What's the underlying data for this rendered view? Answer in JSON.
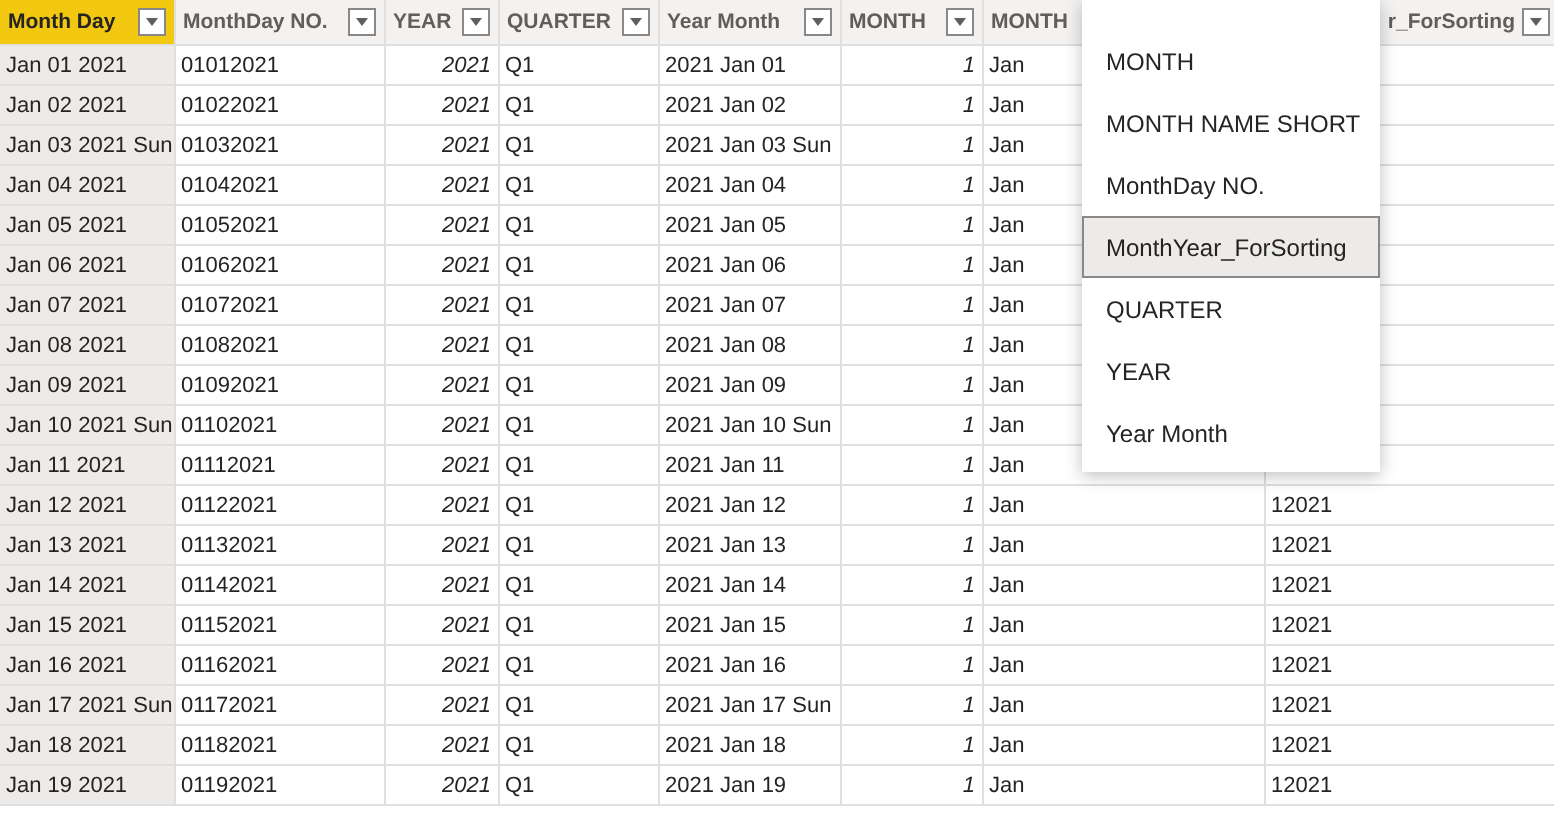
{
  "table": {
    "columns": [
      {
        "label": "Month Day",
        "selected": true,
        "kind": "text",
        "filter": true
      },
      {
        "label": "MonthDay NO.",
        "selected": false,
        "kind": "text",
        "filter": true
      },
      {
        "label": "YEAR",
        "selected": false,
        "kind": "number",
        "filter": true
      },
      {
        "label": "QUARTER",
        "selected": false,
        "kind": "text",
        "filter": true
      },
      {
        "label": "Year Month",
        "selected": false,
        "kind": "text",
        "filter": true
      },
      {
        "label": "MONTH",
        "selected": false,
        "kind": "number",
        "filter": true
      },
      {
        "label": "MONTH",
        "selected": false,
        "kind": "text",
        "filter": false
      },
      {
        "label": "r_ForSorting",
        "selected": false,
        "kind": "text",
        "filter": true
      }
    ],
    "rows": [
      [
        "Jan 01 2021",
        "01012021",
        "2021",
        "Q1",
        "2021 Jan 01",
        "1",
        "Jan",
        ""
      ],
      [
        "Jan 02 2021",
        "01022021",
        "2021",
        "Q1",
        "2021 Jan 02",
        "1",
        "Jan",
        ""
      ],
      [
        "Jan 03 2021 Sun",
        "01032021",
        "2021",
        "Q1",
        "2021 Jan 03 Sun",
        "1",
        "Jan",
        ""
      ],
      [
        "Jan 04 2021",
        "01042021",
        "2021",
        "Q1",
        "2021 Jan 04",
        "1",
        "Jan",
        ""
      ],
      [
        "Jan 05 2021",
        "01052021",
        "2021",
        "Q1",
        "2021 Jan 05",
        "1",
        "Jan",
        ""
      ],
      [
        "Jan 06 2021",
        "01062021",
        "2021",
        "Q1",
        "2021 Jan 06",
        "1",
        "Jan",
        ""
      ],
      [
        "Jan 07 2021",
        "01072021",
        "2021",
        "Q1",
        "2021 Jan 07",
        "1",
        "Jan",
        ""
      ],
      [
        "Jan 08 2021",
        "01082021",
        "2021",
        "Q1",
        "2021 Jan 08",
        "1",
        "Jan",
        ""
      ],
      [
        "Jan 09 2021",
        "01092021",
        "2021",
        "Q1",
        "2021 Jan 09",
        "1",
        "Jan",
        ""
      ],
      [
        "Jan 10 2021 Sun",
        "01102021",
        "2021",
        "Q1",
        "2021 Jan 10 Sun",
        "1",
        "Jan",
        ""
      ],
      [
        "Jan 11 2021",
        "01112021",
        "2021",
        "Q1",
        "2021 Jan 11",
        "1",
        "Jan",
        ""
      ],
      [
        "Jan 12 2021",
        "01122021",
        "2021",
        "Q1",
        "2021 Jan 12",
        "1",
        "Jan",
        "12021"
      ],
      [
        "Jan 13 2021",
        "01132021",
        "2021",
        "Q1",
        "2021 Jan 13",
        "1",
        "Jan",
        "12021"
      ],
      [
        "Jan 14 2021",
        "01142021",
        "2021",
        "Q1",
        "2021 Jan 14",
        "1",
        "Jan",
        "12021"
      ],
      [
        "Jan 15 2021",
        "01152021",
        "2021",
        "Q1",
        "2021 Jan 15",
        "1",
        "Jan",
        "12021"
      ],
      [
        "Jan 16 2021",
        "01162021",
        "2021",
        "Q1",
        "2021 Jan 16",
        "1",
        "Jan",
        "12021"
      ],
      [
        "Jan 17 2021 Sun",
        "01172021",
        "2021",
        "Q1",
        "2021 Jan 17 Sun",
        "1",
        "Jan",
        "12021"
      ],
      [
        "Jan 18 2021",
        "01182021",
        "2021",
        "Q1",
        "2021 Jan 18",
        "1",
        "Jan",
        "12021"
      ],
      [
        "Jan 19 2021",
        "01192021",
        "2021",
        "Q1",
        "2021 Jan 19",
        "1",
        "Jan",
        "12021"
      ]
    ]
  },
  "menu": {
    "items": [
      {
        "label": "MONTH",
        "selected": false
      },
      {
        "label": "MONTH NAME SHORT",
        "selected": false
      },
      {
        "label": "MonthDay NO.",
        "selected": false
      },
      {
        "label": "MonthYear_ForSorting",
        "selected": true
      },
      {
        "label": "QUARTER",
        "selected": false
      },
      {
        "label": "YEAR",
        "selected": false
      },
      {
        "label": "Year Month",
        "selected": false
      }
    ]
  }
}
